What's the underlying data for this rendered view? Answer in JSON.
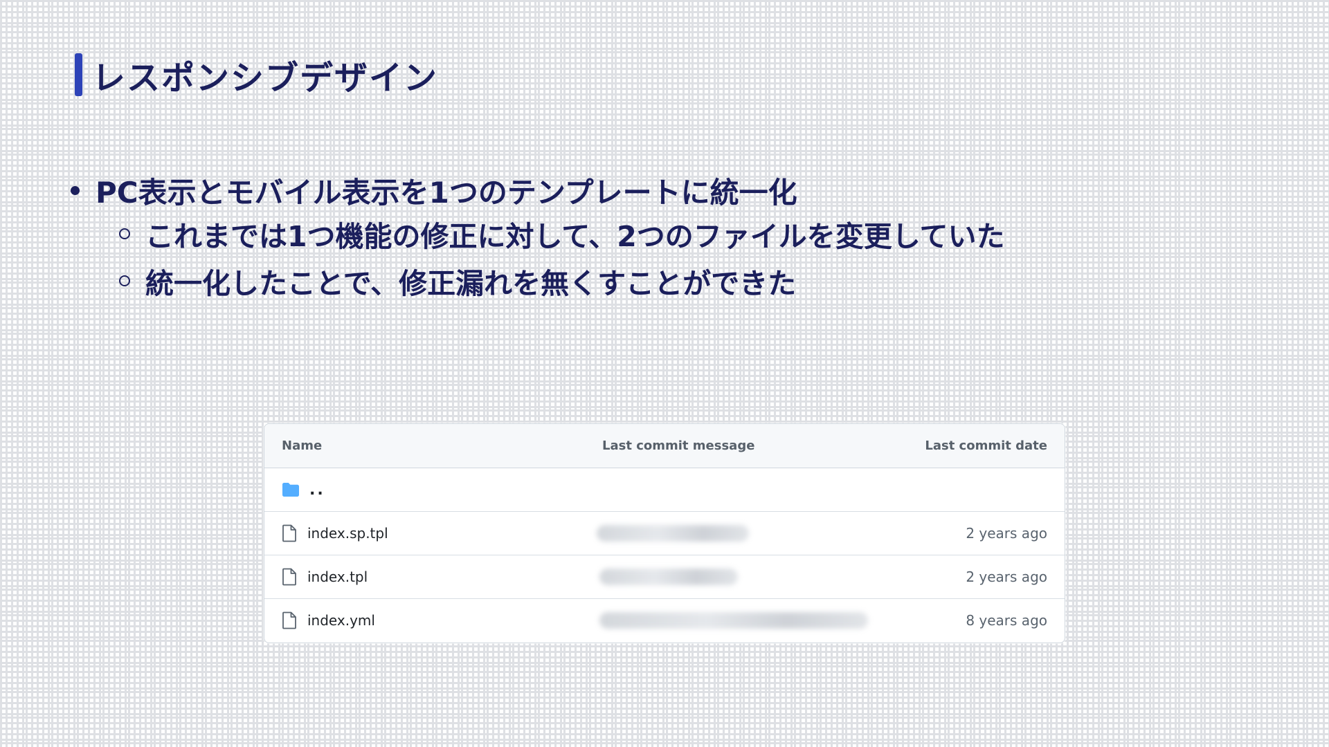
{
  "slide": {
    "title": "レスポンシブデザイン",
    "bullets": [
      "PC表示とモバイル表示を1つのテンプレートに統一化"
    ],
    "sub_bullets": [
      "これまでは1つ機能の修正に対して、2つのファイルを変更していた",
      "統一化したことで、修正漏れを無くすことができた"
    ],
    "accent_color": "#2d43b8",
    "text_color": "#1b1f5c"
  },
  "file_table": {
    "headers": {
      "name": "Name",
      "message": "Last commit message",
      "date": "Last commit date"
    },
    "parent_dir": {
      "label": "..",
      "icon": "folder-icon"
    },
    "rows": [
      {
        "name": "index.sp.tpl",
        "date": "2 years ago",
        "icon": "file-icon",
        "message_redacted": true
      },
      {
        "name": "index.tpl",
        "date": "2 years ago",
        "icon": "file-icon",
        "message_redacted": true
      },
      {
        "name": "index.yml",
        "date": "8 years ago",
        "icon": "file-icon",
        "message_redacted": true
      }
    ]
  }
}
